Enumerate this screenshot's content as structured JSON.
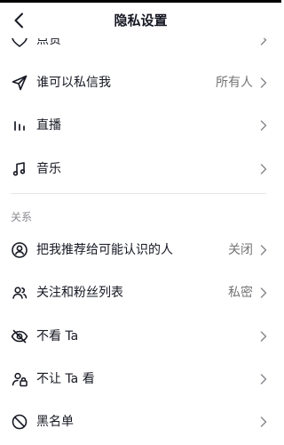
{
  "header": {
    "title": "隐私设置",
    "back_icon": "chevron-left-icon"
  },
  "section_interaction": {
    "items": [
      {
        "label": "点赞",
        "value": "",
        "icon": "heart-icon"
      },
      {
        "label": "谁可以私信我",
        "value": "所有人",
        "icon": "send-icon"
      },
      {
        "label": "直播",
        "value": "",
        "icon": "live-bars-icon"
      },
      {
        "label": "音乐",
        "value": "",
        "icon": "music-note-icon"
      }
    ]
  },
  "section_relations": {
    "title": "关系",
    "items": [
      {
        "label": "把我推荐给可能认识的人",
        "value": "关闭",
        "icon": "person-circle-icon"
      },
      {
        "label": "关注和粉丝列表",
        "value": "私密",
        "icon": "users-icon"
      },
      {
        "label": "不看 Ta",
        "value": "",
        "icon": "eye-off-icon"
      },
      {
        "label": "不让 Ta 看",
        "value": "",
        "icon": "person-lock-icon"
      },
      {
        "label": "黑名单",
        "value": "",
        "icon": "block-icon"
      }
    ]
  },
  "colors": {
    "text": "#161823",
    "secondary": "#757575",
    "divider": "#e6e6e6",
    "chevron": "#8a8b91"
  }
}
